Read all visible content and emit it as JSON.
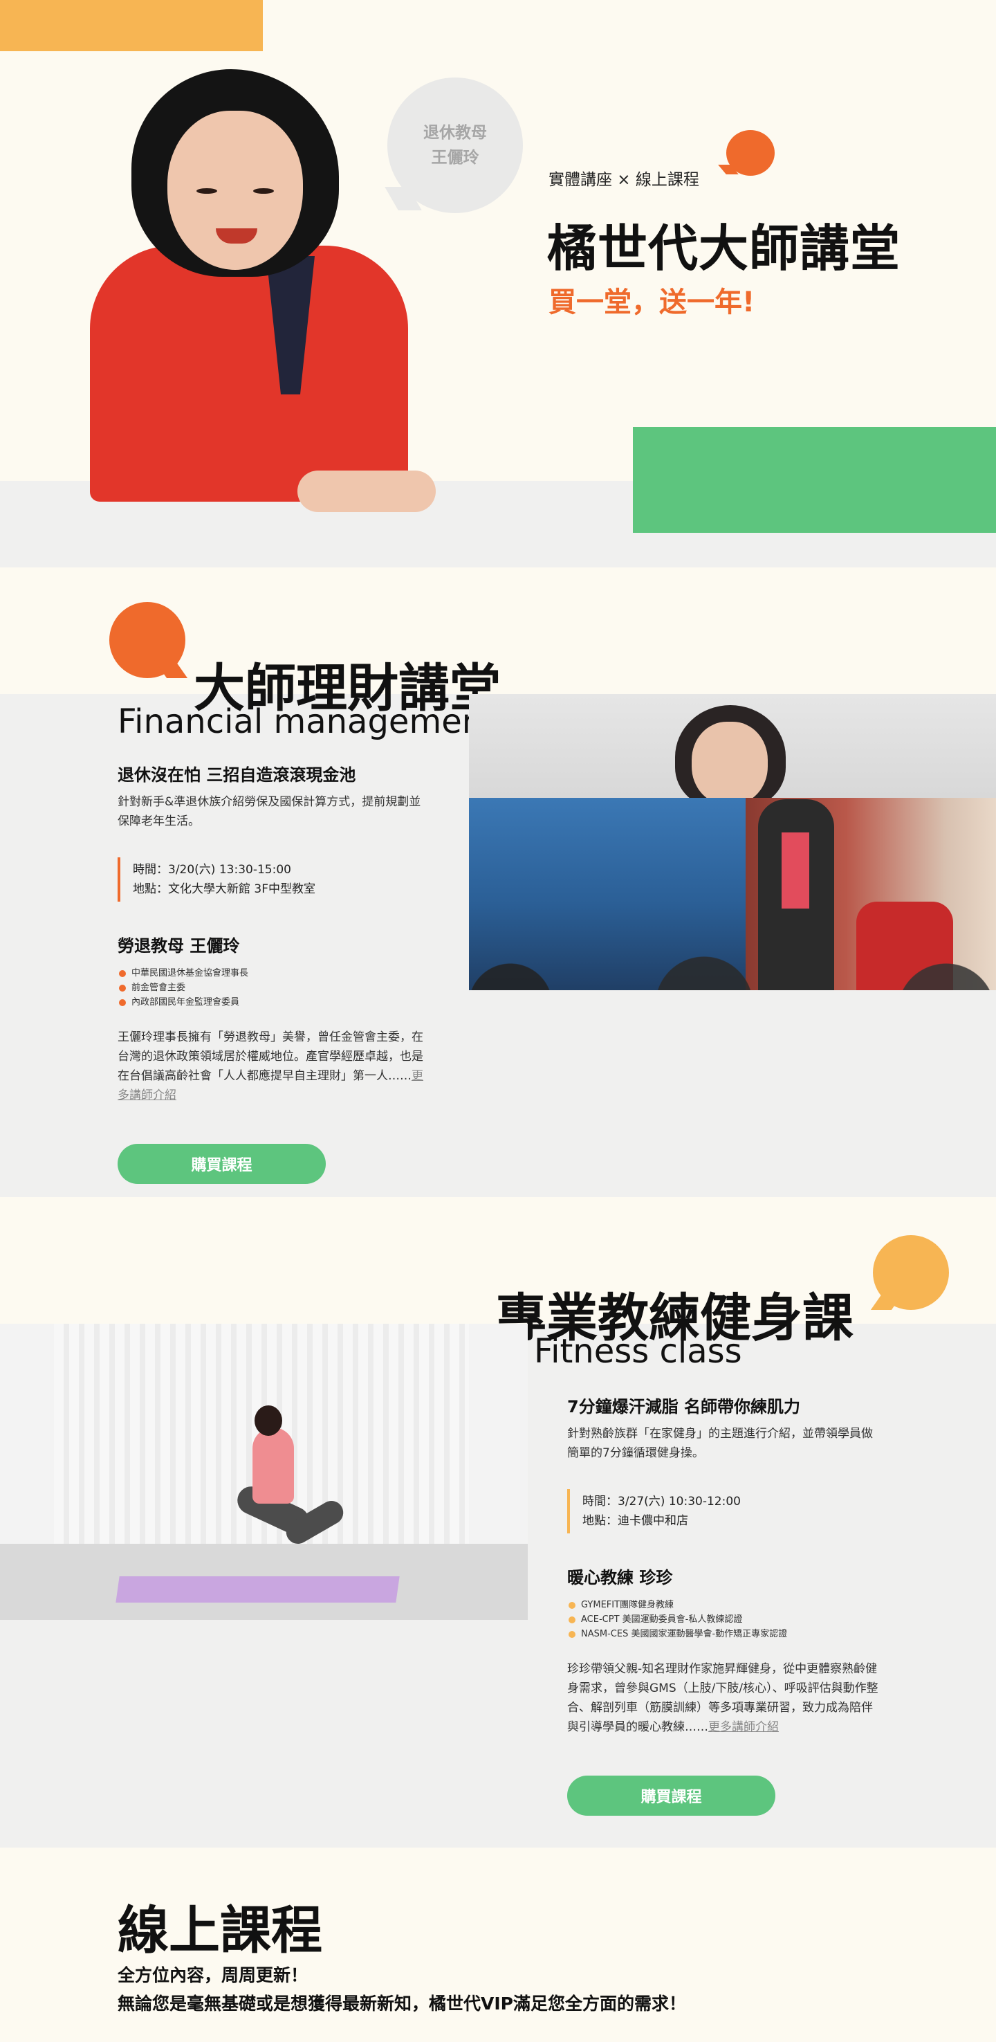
{
  "hero": {
    "bubble_line1": "退休教母",
    "bubble_line2": "王儷玲",
    "subtitle": "實體講座 × 線上課程",
    "title": "橘世代大師講堂",
    "accent": "買一堂，送一年!",
    "accent_color": "#ef6a2c"
  },
  "finance": {
    "title": "大師理財講堂",
    "title_en": "Financial management",
    "course_title": "退休沒在怕 三招自造滾滾現金池",
    "course_desc": "針對新手&準退休族介紹勞保及國保計算方式，提前規劃並保障老年生活。",
    "time": "時間：3/20(六) 13:30-15:00",
    "place": "地點：文化大學大新館 3F中型教室",
    "teacher": "勞退教母 王儷玲",
    "credentials": [
      "中華民國退休基金協會理事長",
      "前金管會主委",
      "內政部國民年金監理會委員"
    ],
    "bio": "王儷玲理事長擁有「勞退教母」美譽，曾任金管會主委，在台灣的退休政策領域居於權威地位。產官學經歷卓越，也是在台倡議高齡社會「人人都應提早自主理財」第一人……",
    "more": "更多講師介紹",
    "buy": "購買課程"
  },
  "fitness": {
    "title": "專業教練健身課",
    "title_en": "Fitness class",
    "course_title": "7分鐘爆汗減脂 名師帶你練肌力",
    "course_desc": "針對熟齡族群「在家健身」的主題進行介紹，並帶領學員做簡單的7分鐘循環健身操。",
    "time": "時間：3/27(六) 10:30-12:00",
    "place": "地點：迪卡儂中和店",
    "teacher": "暖心教練 珍珍",
    "credentials": [
      "GYMEFIT團隊健身教練",
      "ACE-CPT 美國運動委員會-私人教練認證",
      "NASM-CES 美國國家運動醫學會-動作矯正專家認證"
    ],
    "bio": "珍珍帶領父親-知名理財作家施昇輝健身，從中更體察熟齡健身需求，曾參與GMS（上肢/下肢/核心）、呼吸評估與動作整合、解剖列車（筋膜訓練）等多項專業研習，致力成為陪伴與引導學員的暖心教練……",
    "more": "更多講師介紹",
    "buy": "購買課程"
  },
  "online": {
    "title": "線上課程",
    "line1": "全方位內容，周周更新！",
    "line2": "無論您是毫無基礎或是想獲得最新新知，橘世代VIP滿足您全方面的需求！"
  },
  "colors": {
    "orange": "#ef6a2c",
    "yellow": "#f7b553",
    "green": "#5dc57e",
    "cream": "#fdfaf1",
    "gray": "#f0f0ef"
  }
}
